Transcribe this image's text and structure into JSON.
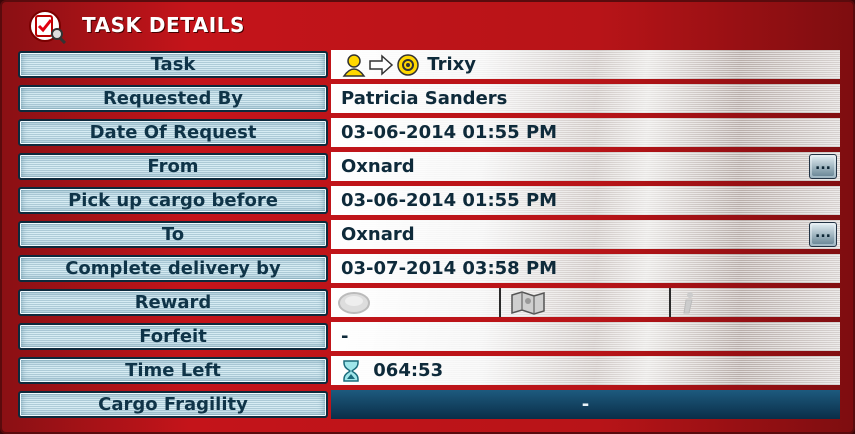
{
  "window": {
    "title": "TASK DETAILS"
  },
  "rows": {
    "task": {
      "label": "Task",
      "value": "Trixy"
    },
    "requested": {
      "label": "Requested By",
      "value": "Patricia Sanders"
    },
    "date": {
      "label": "Date Of Request",
      "value": "03-06-2014 01:55 PM"
    },
    "from": {
      "label": "From",
      "value": "Oxnard",
      "button": "..."
    },
    "pickup": {
      "label": "Pick up cargo before",
      "value": "03-06-2014 01:55 PM"
    },
    "to": {
      "label": "To",
      "value": "Oxnard",
      "button": "..."
    },
    "complete": {
      "label": "Complete delivery by",
      "value": "03-07-2014 03:58 PM"
    },
    "reward": {
      "label": "Reward",
      "icons": [
        "coin-icon",
        "map-icon",
        "info-icon"
      ]
    },
    "forfeit": {
      "label": "Forfeit",
      "value": "-"
    },
    "timeleft": {
      "label": "Time Left",
      "value": "064:53"
    },
    "fragility": {
      "label": "Cargo Fragility",
      "value": "-"
    }
  },
  "colors": {
    "frame": "#c4141a",
    "label_text": "#0f3448",
    "dark_value": "#0a2e48"
  }
}
